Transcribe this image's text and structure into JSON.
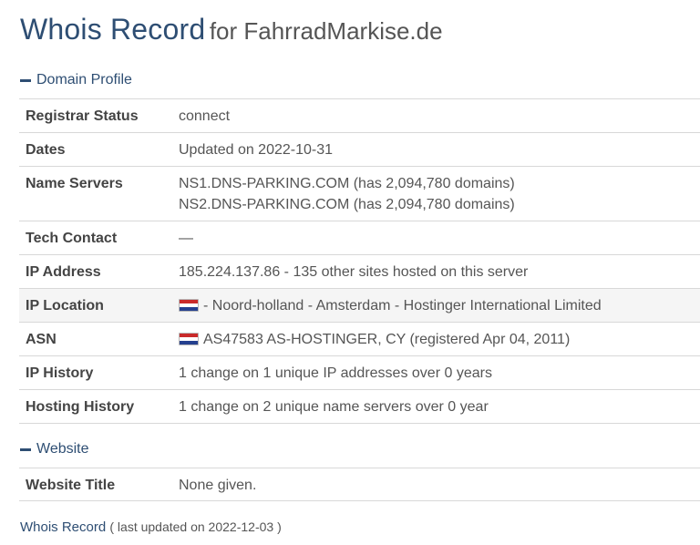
{
  "header": {
    "title": "Whois Record",
    "for_text": "for FahrradMarkise.de"
  },
  "sections": {
    "domain_profile": {
      "title": "Domain Profile",
      "rows": {
        "registrar_status": {
          "label": "Registrar Status",
          "value": "connect"
        },
        "dates": {
          "label": "Dates",
          "value": "Updated on 2022-10-31"
        },
        "name_servers": {
          "label": "Name Servers",
          "values": [
            "NS1.DNS-PARKING.COM (has 2,094,780 domains)",
            "NS2.DNS-PARKING.COM (has 2,094,780 domains)"
          ]
        },
        "tech_contact": {
          "label": "Tech Contact",
          "value": "—"
        },
        "ip_address": {
          "label": "IP Address",
          "value": "185.224.137.86 - 135 other sites hosted on this server"
        },
        "ip_location": {
          "label": "IP Location",
          "value": "- Noord-holland - Amsterdam - Hostinger International Limited",
          "flag": "netherlands-flag-icon"
        },
        "asn": {
          "label": "ASN",
          "value": "AS47583 AS-HOSTINGER, CY (registered Apr 04, 2011)",
          "flag": "netherlands-flag-icon"
        },
        "ip_history": {
          "label": "IP History",
          "value": "1 change on 1 unique IP addresses over 0 years"
        },
        "hosting_history": {
          "label": "Hosting History",
          "value": "1 change on 2 unique name servers over 0 year"
        }
      }
    },
    "website": {
      "title": "Website",
      "rows": {
        "website_title": {
          "label": "Website Title",
          "value": "None given."
        }
      }
    }
  },
  "footer": {
    "link": "Whois Record",
    "updated": "( last updated on 2022-12-03 )"
  },
  "colors": {
    "accent": "#2e4e73",
    "row_shade": "#f5f5f5",
    "border": "#d8d8d8"
  }
}
